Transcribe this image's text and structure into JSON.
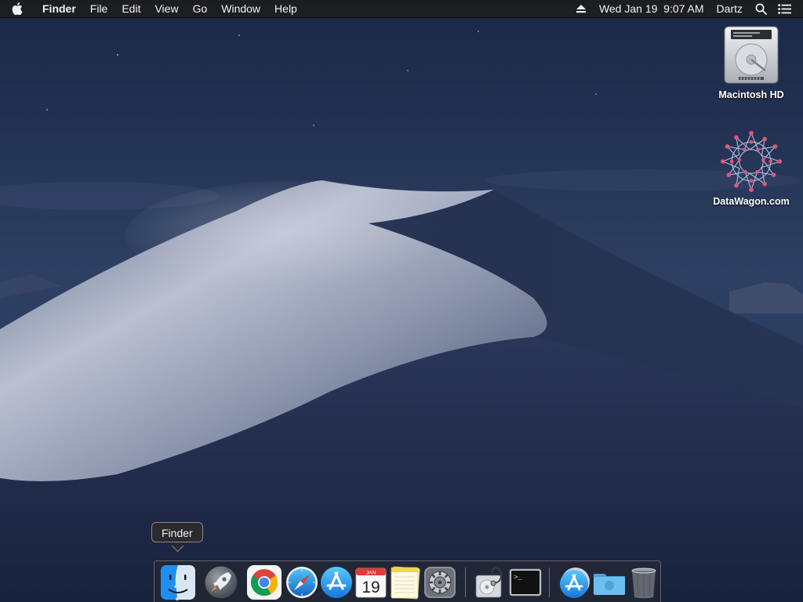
{
  "menubar": {
    "app_name": "Finder",
    "menus": [
      "File",
      "Edit",
      "View",
      "Go",
      "Window",
      "Help"
    ],
    "date_time": "Wed Jan 19  9:07 AM",
    "user": "Dartz"
  },
  "desktop": {
    "icons": [
      {
        "label": "Macintosh HD",
        "icon": "hard-drive-icon"
      },
      {
        "label": "DataWagon.com",
        "icon": "network-mesh-icon"
      }
    ]
  },
  "tooltip": {
    "text": "Finder"
  },
  "dock": {
    "items": [
      {
        "name": "Finder",
        "icon": "finder-icon",
        "running": true
      },
      {
        "name": "Launchpad",
        "icon": "rocket-icon"
      },
      {
        "name": "Google Chrome",
        "icon": "chrome-icon"
      },
      {
        "name": "Safari",
        "icon": "compass-icon"
      },
      {
        "name": "App Store",
        "icon": "app-store-icon"
      },
      {
        "name": "Calendar",
        "icon": "calendar-icon",
        "month": "JAN",
        "day": "19"
      },
      {
        "name": "Notes",
        "icon": "notes-icon"
      },
      {
        "name": "System Preferences",
        "icon": "gear-icon"
      },
      {
        "name": "Disk Utility",
        "icon": "disk-utility-icon"
      },
      {
        "name": "Terminal",
        "icon": "terminal-icon",
        "prompt": ">_"
      },
      {
        "name": "App Store Downloads",
        "icon": "downloads-icon"
      },
      {
        "name": "Folder",
        "icon": "folder-icon"
      },
      {
        "name": "Trash",
        "icon": "trash-icon"
      }
    ]
  },
  "colors": {
    "sky_top": "#1d2b4d",
    "sky_bottom": "#2e4266",
    "dune_light": "#c9cfdd",
    "dune_shadow": "#1c2744"
  }
}
